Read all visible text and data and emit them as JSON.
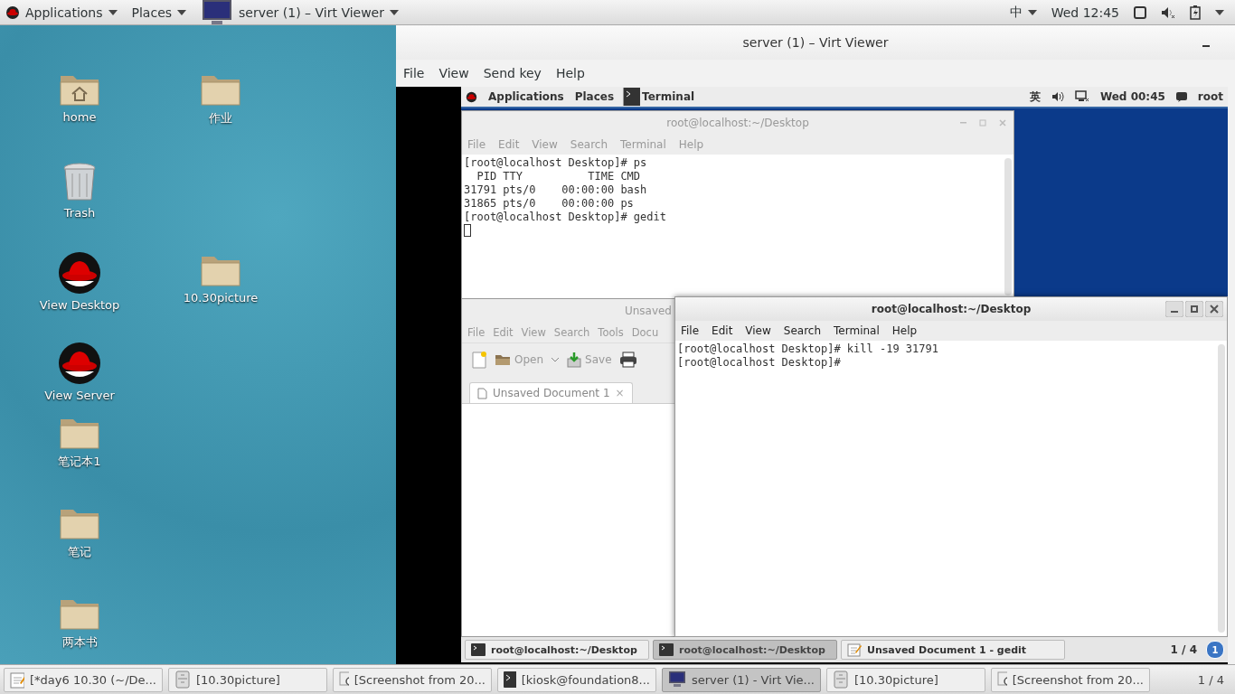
{
  "top_bar": {
    "applications": "Applications",
    "places": "Places",
    "window_menu": "server (1) – Virt Viewer",
    "input_method": "中",
    "clock": "Wed 12:45"
  },
  "desktop_icons": [
    {
      "label": "home",
      "kind": "home"
    },
    {
      "label": "Trash",
      "kind": "trash"
    },
    {
      "label": "View Desktop",
      "kind": "redhat"
    },
    {
      "label": "View Server",
      "kind": "redhat"
    },
    {
      "label": "笔记本1",
      "kind": "folder"
    },
    {
      "label": "笔记",
      "kind": "folder"
    },
    {
      "label": "两本书",
      "kind": "folder"
    },
    {
      "label": "作业",
      "kind": "folder"
    },
    {
      "label": "10.30picture",
      "kind": "folder"
    }
  ],
  "viewer": {
    "title": "server (1) – Virt Viewer",
    "menu": [
      "File",
      "View",
      "Send key",
      "Help"
    ]
  },
  "vm": {
    "top_bar": {
      "applications": "Applications",
      "places": "Places",
      "active_app": "Terminal",
      "input_method": "英",
      "clock": "Wed 00:45",
      "user": "root"
    },
    "terminal_back": {
      "title": "root@localhost:~/Desktop",
      "menu": [
        "File",
        "Edit",
        "View",
        "Search",
        "Terminal",
        "Help"
      ],
      "lines": [
        "[root@localhost Desktop]# ps",
        "  PID TTY          TIME CMD",
        "31791 pts/0    00:00:00 bash",
        "31865 pts/0    00:00:00 ps",
        "[root@localhost Desktop]# gedit"
      ]
    },
    "gedit": {
      "title": "Unsaved",
      "menu": [
        "File",
        "Edit",
        "View",
        "Search",
        "Tools",
        "Docu"
      ],
      "open": "Open",
      "save": "Save",
      "tab": "Unsaved Document 1",
      "tab_close": "×"
    },
    "terminal_front": {
      "title": "root@localhost:~/Desktop",
      "menu": [
        "File",
        "Edit",
        "View",
        "Search",
        "Terminal",
        "Help"
      ],
      "lines": [
        "[root@localhost Desktop]# kill -19 31791",
        "[root@localhost Desktop]#"
      ]
    },
    "taskbar": {
      "items": [
        {
          "label": "root@localhost:~/Desktop",
          "kind": "terminal",
          "selected": false
        },
        {
          "label": "root@localhost:~/Desktop",
          "kind": "terminal",
          "selected": true
        },
        {
          "label": "Unsaved Document 1 - gedit",
          "kind": "editor",
          "selected": false
        }
      ],
      "pager": "1 / 4",
      "notifications": "1"
    }
  },
  "taskbar": {
    "items": [
      {
        "label": "[*day6 10.30 (~/De...",
        "kind": "editor",
        "selected": false
      },
      {
        "label": "[10.30picture]",
        "kind": "files",
        "selected": false
      },
      {
        "label": "[Screenshot from 20...",
        "kind": "viewer",
        "selected": false
      },
      {
        "label": "[kiosk@foundation8...",
        "kind": "terminal",
        "selected": false
      },
      {
        "label": "server (1) - Virt Vie...",
        "kind": "monitor",
        "selected": true
      },
      {
        "label": "[10.30picture]",
        "kind": "files",
        "selected": false
      },
      {
        "label": "[Screenshot from 20...",
        "kind": "viewer",
        "selected": false
      }
    ],
    "pager": "1 / 4"
  }
}
